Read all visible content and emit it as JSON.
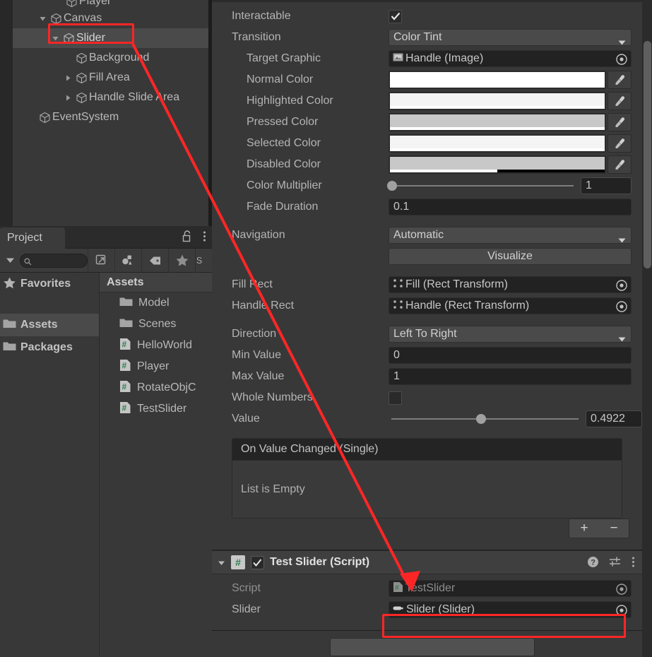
{
  "hierarchy": {
    "rows": [
      {
        "label": "Player",
        "indent": 1,
        "twisty": "none",
        "selected": false,
        "clipped": true
      },
      {
        "label": "Canvas",
        "indent": 1,
        "twisty": "down",
        "selected": false,
        "clipped": false
      },
      {
        "label": "Slider",
        "indent": 2,
        "twisty": "down",
        "selected": true,
        "clipped": false
      },
      {
        "label": "Background",
        "indent": 3,
        "twisty": "none",
        "selected": false,
        "clipped": false
      },
      {
        "label": "Fill Area",
        "indent": 3,
        "twisty": "right",
        "selected": false,
        "clipped": false
      },
      {
        "label": "Handle Slide Area",
        "indent": 3,
        "twisty": "right",
        "selected": false,
        "clipped": false
      },
      {
        "label": "EventSystem",
        "indent": 1,
        "twisty": "none",
        "selected": false,
        "clipped": false
      }
    ]
  },
  "project": {
    "tab_label": "Project",
    "lock_icon": "lock-open-icon",
    "menu_icon": "kebab-menu-icon",
    "search": {
      "value": "",
      "placeholder": ""
    },
    "toolbar_icons": [
      "caret-down-icon",
      "search-icon",
      "open-in-new-icon",
      "avatar-filter-icon",
      "tag-icon",
      "star-icon",
      "label-icon"
    ],
    "tree": [
      {
        "label": "Favorites",
        "icon": "star-icon",
        "selected": false
      },
      {
        "label": "Assets",
        "icon": "folder-icon",
        "selected": true
      },
      {
        "label": "Packages",
        "icon": "folder-icon",
        "selected": false
      }
    ],
    "content_header": "Assets",
    "assets": [
      {
        "label": "Model",
        "icon": "folder-icon"
      },
      {
        "label": "Scenes",
        "icon": "folder-icon"
      },
      {
        "label": "HelloWorld",
        "icon": "csharp-script-icon"
      },
      {
        "label": "Player",
        "icon": "csharp-script-icon"
      },
      {
        "label": "RotateObjC",
        "icon": "csharp-script-icon"
      },
      {
        "label": "TestSlider",
        "icon": "csharp-script-icon"
      }
    ]
  },
  "inspector": {
    "interactable": {
      "label": "Interactable",
      "checked": true
    },
    "transition": {
      "label": "Transition",
      "value": "Color Tint"
    },
    "target_graphic": {
      "label": "Target Graphic",
      "value": "Handle (Image)",
      "icon": "image-component-icon"
    },
    "normal_color": {
      "label": "Normal Color",
      "color": "#ffffff",
      "alpha_pct": 100
    },
    "highlighted_color": {
      "label": "Highlighted Color",
      "color": "#f4f4f4",
      "alpha_pct": 100
    },
    "pressed_color": {
      "label": "Pressed Color",
      "color": "#c8c8c8",
      "alpha_pct": 100
    },
    "selected_color": {
      "label": "Selected Color",
      "color": "#f4f4f4",
      "alpha_pct": 100
    },
    "disabled_color": {
      "label": "Disabled Color",
      "color": "#c8c8c8",
      "alpha_pct": 50
    },
    "color_multiplier": {
      "label": "Color Multiplier",
      "value": "1",
      "knob_pct": 0
    },
    "fade_duration": {
      "label": "Fade Duration",
      "value": "0.1"
    },
    "navigation": {
      "label": "Navigation",
      "value": "Automatic"
    },
    "visualize": {
      "label": "Visualize"
    },
    "fill_rect": {
      "label": "Fill Rect",
      "value": "Fill (Rect Transform)",
      "icon": "rect-transform-icon"
    },
    "handle_rect": {
      "label": "Handle Rect",
      "value": "Handle (Rect Transform)",
      "icon": "rect-transform-icon"
    },
    "direction": {
      "label": "Direction",
      "value": "Left To Right"
    },
    "min_value": {
      "label": "Min Value",
      "value": "0"
    },
    "max_value": {
      "label": "Max Value",
      "value": "1"
    },
    "whole_numbers": {
      "label": "Whole Numbers",
      "checked": false
    },
    "value": {
      "label": "Value",
      "value": "0.4922",
      "knob_pct": 48
    },
    "on_value_changed": {
      "header": "On Value Changed (Single)",
      "empty_text": "List is Empty",
      "add_label": "+",
      "remove_label": "−"
    }
  },
  "script_component": {
    "title": "Test Slider (Script)",
    "enabled": true,
    "badge": "#",
    "help_icon": "help-icon",
    "preset_icon": "preset-settings-icon",
    "menu_icon": "kebab-menu-icon",
    "script_field": {
      "label": "Script",
      "value": "TestSlider",
      "icon": "csharp-script-icon"
    },
    "slider_field": {
      "label": "Slider",
      "value": "Slider (Slider)",
      "icon": "slider-component-icon"
    }
  },
  "annotations": {
    "accent_color": "#fd2626",
    "highlight_slider_hierarchy": true,
    "highlight_slider_field": true,
    "arrow_label": "arrow-from-slider-to-slider-field"
  }
}
